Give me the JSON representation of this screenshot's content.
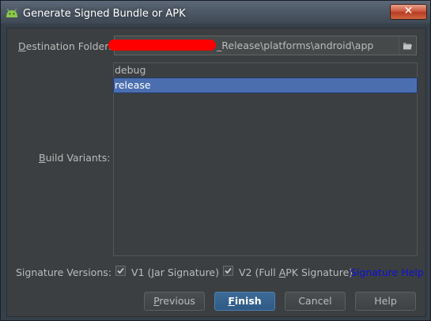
{
  "window": {
    "title": "Generate Signed Bundle or APK",
    "close_symbol": "✕"
  },
  "form": {
    "destination_label_first": "D",
    "destination_label_rest": "estination Folder:",
    "destination_value": "_Release\\platforms\\android\\app",
    "build_variants_label_first": "B",
    "build_variants_label_rest": "uild Variants:",
    "build_variants": [
      {
        "label": "debug",
        "selected": false
      },
      {
        "label": "release",
        "selected": true
      }
    ],
    "signature_label": "Signature Versions:",
    "v1": {
      "prefix": "V1 (",
      "mnemonic": "J",
      "rest": "ar Signature)",
      "checked": true
    },
    "v2": {
      "prefix": "V2 (Full ",
      "mnemonic": "A",
      "rest": "PK Signature)",
      "checked": true
    },
    "signature_help": "Signature Help"
  },
  "buttons": {
    "previous_first": "P",
    "previous_rest": "revious",
    "finish_first": "F",
    "finish_rest": "inish",
    "cancel": "Cancel",
    "help": "Help"
  },
  "colors": {
    "dialog_bg": "#3c3f41",
    "selection": "#4b6eaf",
    "link": "#0a11d8",
    "default_button": "#365f8a"
  },
  "icons": {
    "window_icon": "android-icon",
    "browse": "folder-icon",
    "checkbox": "checkmark-icon"
  }
}
